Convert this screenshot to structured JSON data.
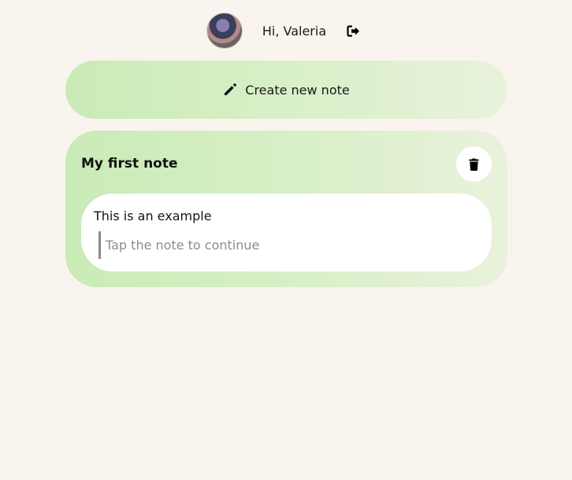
{
  "header": {
    "greeting": "Hi, Valeria",
    "avatar_icon": "user-avatar",
    "logout_icon": "sign-out-icon"
  },
  "create_button": {
    "label": "Create new note",
    "icon": "pencil-icon"
  },
  "notes": [
    {
      "title": "My first note",
      "text": "This is an example",
      "hint": "Tap the note to continue",
      "delete_icon": "trash-icon"
    }
  ],
  "colors": {
    "background": "#faf4ef",
    "card_gradient_start": "#c9ebb6",
    "card_gradient_end": "#e9f2dc",
    "card_body": "#ffffff"
  }
}
